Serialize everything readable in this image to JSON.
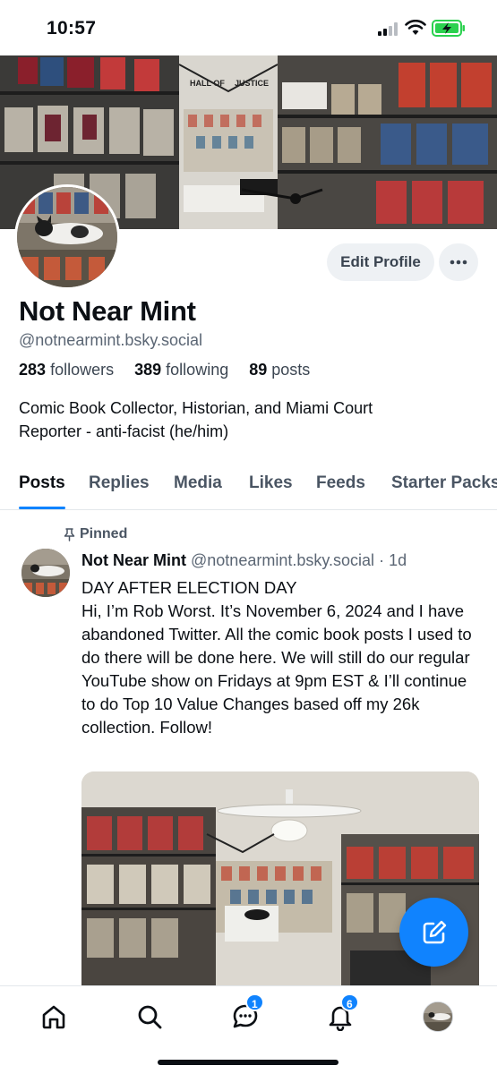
{
  "status_bar": {
    "time": "10:57"
  },
  "profile": {
    "display_name": "Not Near Mint",
    "handle": "@notnearmint.bsky.social",
    "followers_count": "283",
    "followers_label": "followers",
    "following_count": "389",
    "following_label": "following",
    "posts_count": "89",
    "posts_label": "posts",
    "bio_line1": "Comic Book Collector, Historian, and Miami Court",
    "bio_line2": "Reporter - anti-facist (he/him)",
    "edit_button": "Edit Profile",
    "banner_sign_left": "HALL OF",
    "banner_sign_right": "JUSTICE"
  },
  "tabs": [
    {
      "label": "Posts",
      "active": true
    },
    {
      "label": "Replies",
      "active": false
    },
    {
      "label": "Media",
      "active": false
    },
    {
      "label": "Likes",
      "active": false
    },
    {
      "label": "Feeds",
      "active": false
    },
    {
      "label": "Starter Packs",
      "active": false
    }
  ],
  "post": {
    "pinned_label": "Pinned",
    "author_name": "Not Near Mint",
    "author_handle": "@notnearmint.bsky.social",
    "separator": "·",
    "timestamp": "1d",
    "lines": [
      "DAY AFTER ELECTION DAY",
      "Hi, I’m Rob Worst. It’s November 6, 2024 and I have abandoned Twitter. All the comic book posts I used to do there will be done here. We will still do our regular YouTube show on Fridays at 9pm EST & I’ll continue to do Top 10 Value Changes based off my 26k collection. Follow!"
    ]
  },
  "bottom_nav": {
    "icons": [
      "home-icon",
      "search-icon",
      "chat-icon",
      "bell-icon",
      "profile-avatar"
    ],
    "chat_badge": "1",
    "notifications_badge": "6"
  },
  "colors": {
    "accent": "#1083fe",
    "muted": "#5b6674",
    "button_bg": "#eef1f4"
  }
}
